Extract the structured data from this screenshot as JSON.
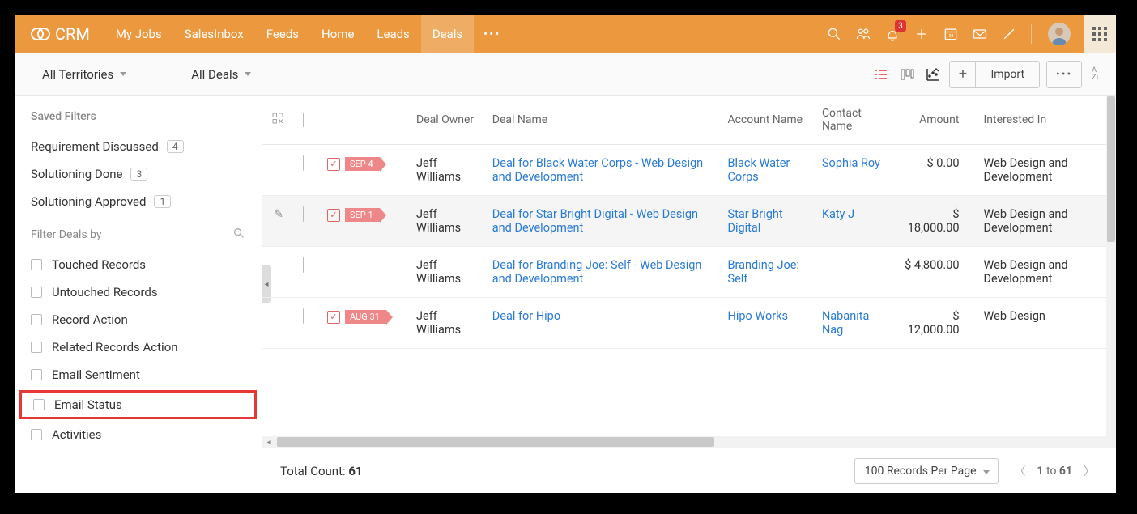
{
  "brand": "CRM",
  "nav": [
    "My Jobs",
    "SalesInbox",
    "Feeds",
    "Home",
    "Leads",
    "Deals"
  ],
  "activeNav": "Deals",
  "notificationCount": "3",
  "toolbar": {
    "territories": "All Territories",
    "deals": "All Deals",
    "import": "Import"
  },
  "sidebar": {
    "savedFiltersTitle": "Saved Filters",
    "savedFilters": [
      {
        "label": "Requirement Discussed",
        "count": "4"
      },
      {
        "label": "Solutioning Done",
        "count": "3"
      },
      {
        "label": "Solutioning Approved",
        "count": "1"
      }
    ],
    "filterByTitle": "Filter Deals by",
    "filters": [
      "Touched Records",
      "Untouched Records",
      "Record Action",
      "Related Records Action",
      "Email Sentiment",
      "Email Status",
      "Activities"
    ],
    "highlightedFilter": "Email Status"
  },
  "columns": [
    "Deal Owner",
    "Deal Name",
    "Account Name",
    "Contact Name",
    "Amount",
    "Interested In"
  ],
  "rows": [
    {
      "flag": "SEP 4",
      "owner": "Jeff Williams",
      "deal": "Deal for Black Water Corps - Web Design and Development",
      "account": "Black Water Corps",
      "contact": "Sophia Roy",
      "amount": "$ 0.00",
      "interested": "Web Design and Development"
    },
    {
      "flag": "SEP 1",
      "owner": "Jeff Williams",
      "deal": "Deal for Star Bright Digital - Web Design and Development",
      "account": "Star Bright Digital",
      "contact": "Katy J",
      "amount": "$ 18,000.00",
      "interested": "Web Design and Development",
      "hover": true
    },
    {
      "flag": "",
      "owner": "Jeff Williams",
      "deal": "Deal for Branding Joe: Self - Web Design and Development",
      "account": "Branding Joe: Self",
      "contact": "",
      "amount": "$ 4,800.00",
      "interested": "Web Design and Development"
    },
    {
      "flag": "AUG 31",
      "owner": "Jeff Williams",
      "deal": "Deal for Hipo",
      "account": "Hipo Works",
      "contact": "Nabanita Nag",
      "amount": "$ 12,000.00",
      "interested": "Web Design"
    }
  ],
  "footer": {
    "totalCountLabel": "Total Count: ",
    "totalCount": "61",
    "perPage": "100 Records Per Page",
    "pageFrom": "1",
    "pageTo": "61",
    "pageSep": " to "
  }
}
